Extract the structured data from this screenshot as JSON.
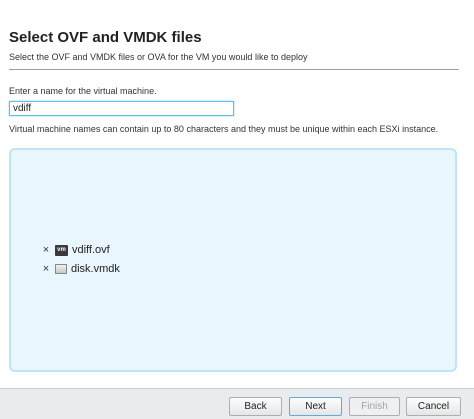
{
  "header": {
    "title": "Select OVF and VMDK files",
    "subtitle": "Select the OVF and VMDK files or OVA for the VM you would like to deploy"
  },
  "vm_name": {
    "label": "Enter a name for the virtual machine.",
    "value": "vdiff",
    "hint": "Virtual machine names can contain up to 80 characters and they must be unique within each ESXi instance."
  },
  "files": {
    "items": [
      {
        "remove": "×",
        "icon": "vm-icon",
        "icon_text": "vm",
        "name": "vdiff.ovf"
      },
      {
        "remove": "×",
        "icon": "disk-icon",
        "name": "disk.vmdk"
      }
    ]
  },
  "footer": {
    "back_label": "Back",
    "next_label": "Next",
    "finish_label": "Finish",
    "cancel_label": "Cancel"
  },
  "colors": {
    "input_focus_border": "#5bc0eb",
    "drop_zone_bg": "#eaf6fd",
    "drop_zone_border": "#bfe4f6",
    "footer_bg": "#e9ecee",
    "disabled_text": "#a0a4a8"
  }
}
